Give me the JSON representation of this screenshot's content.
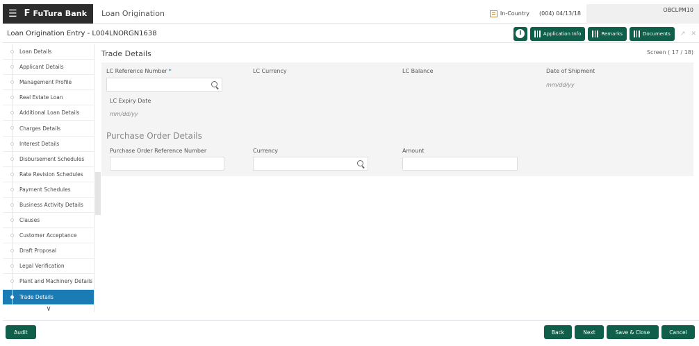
{
  "header": {
    "brand_name": "FuTura Bank",
    "brand_mark": "F",
    "menu_icon": "hamburger-icon",
    "app_title": "Loan Origination",
    "country": "In-Country",
    "branch_date": "(004) 04/13/18",
    "user": "OBCLPM10"
  },
  "subheader": {
    "title": "Loan Origination Entry - L004LNORGN1638",
    "info_icon": "i",
    "buttons": [
      "Application Info",
      "Remarks",
      "Documents"
    ],
    "minimize_icon": "↗",
    "close_icon": "✕"
  },
  "sidebar": {
    "items": [
      "Loan Details",
      "Applicant Details",
      "Management Profile",
      "Real Estate Loan",
      "Additional Loan Details",
      "Charges Details",
      "Interest Details",
      "Disbursement Schedules",
      "Rate Revision Schedules",
      "Payment Schedules",
      "Business Activity Details",
      "Clauses",
      "Customer Acceptance",
      "Draft Proposal",
      "Legal Verification",
      "Plant and Machinery Details",
      "Trade Details"
    ],
    "active_item": "Trade Details",
    "chevron": "∨"
  },
  "main": {
    "section_title": "Trade Details",
    "screen_count": "Screen ( 17 / 18)",
    "lc_reference_label": "LC Reference Number",
    "required_mark": "*",
    "lc_reference_value": "",
    "lc_currency_label": "LC Currency",
    "lc_balance_label": "LC Balance",
    "date_of_shipment_label": "Date of Shipment",
    "date_of_shipment_placeholder": "mm/dd/yy",
    "lc_expiry_label": "LC Expiry Date",
    "lc_expiry_placeholder": "mm/dd/yy",
    "po_group_title": "Purchase Order Details",
    "po_reference_label": "Purchase Order Reference Number",
    "po_reference_value": "",
    "currency_label": "Currency",
    "currency_value": "",
    "amount_label": "Amount",
    "amount_value": ""
  },
  "footer": {
    "audit": "Audit",
    "back": "Back",
    "next": "Next",
    "save_close": "Save & Close",
    "cancel": "Cancel"
  },
  "colors": {
    "primary_green": "#0f5f4a",
    "active_blue": "#1a7bb5",
    "brand_dark": "#2c2c2c"
  }
}
